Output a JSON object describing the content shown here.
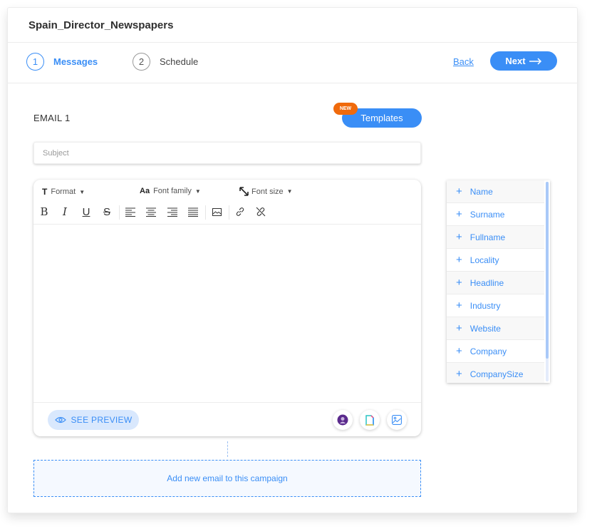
{
  "header": {
    "title": "Spain_Director_Newspapers"
  },
  "steps": [
    {
      "number": "1",
      "label": "Messages",
      "active": true
    },
    {
      "number": "2",
      "label": "Schedule",
      "active": false
    }
  ],
  "nav": {
    "back_label": "Back",
    "next_label": "Next",
    "next_icon": "arrow-right-icon"
  },
  "email": {
    "label": "EMAIL 1",
    "templates_label": "Templates",
    "new_badge": "NEW",
    "subject_placeholder": "Subject",
    "subject_value": ""
  },
  "toolbar": {
    "format_label": "Format",
    "font_family_label": "Font family",
    "font_size_label": "Font size",
    "format_icon_glyph": "T",
    "font_family_icon_glyph": "Aa",
    "bold_glyph": "B",
    "italic_glyph": "I",
    "underline_glyph": "U",
    "strike_glyph": "S"
  },
  "editor_footer": {
    "preview_label": "SEE PREVIEW",
    "actions": [
      "avatar-signature-icon",
      "file-icon",
      "image-icon"
    ]
  },
  "add_email_label": "Add new email to this campaign",
  "variables": [
    "Name",
    "Surname",
    "Fullname",
    "Locality",
    "Headline",
    "Industry",
    "Website",
    "Company",
    "CompanySize"
  ],
  "colors": {
    "accent": "#3a8ef6",
    "badge": "#f06a0c",
    "preview_bg": "#d9e8fd"
  }
}
